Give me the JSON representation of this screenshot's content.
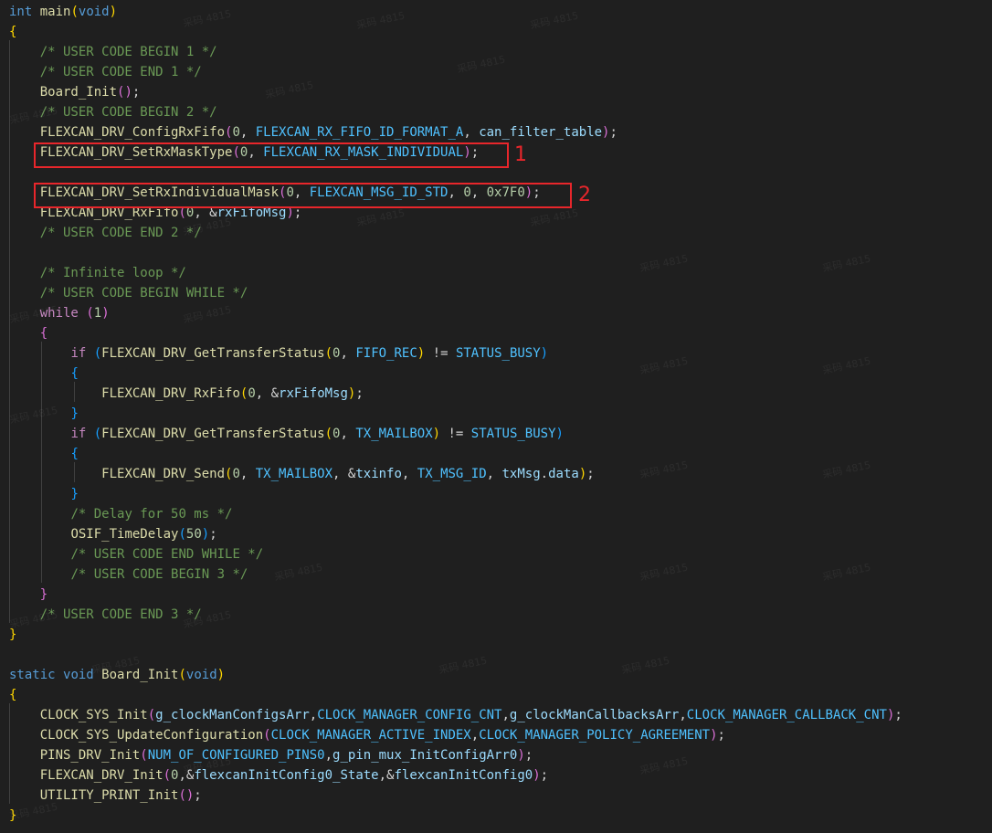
{
  "annotations": {
    "mark1": "1",
    "mark2": "2"
  },
  "watermark": "采码 4815",
  "colors": {
    "background": "#1f1f1f",
    "keyword": "#569cd6",
    "control": "#c586c0",
    "function": "#dcdcaa",
    "number": "#b5cea8",
    "macro": "#4fc1ff",
    "variable": "#9cdcfe",
    "comment": "#6a9955",
    "highlight": "#e8262b"
  },
  "code_lines": [
    [
      [
        "kw",
        "int"
      ],
      [
        "pl",
        " "
      ],
      [
        "fn",
        "main"
      ],
      [
        "br1",
        "("
      ],
      [
        "kw",
        "void"
      ],
      [
        "br1",
        ")"
      ]
    ],
    [
      [
        "br1",
        "{"
      ]
    ],
    [
      [
        "pl",
        "    "
      ],
      [
        "cm",
        "/* USER CODE BEGIN 1 */"
      ]
    ],
    [
      [
        "pl",
        "    "
      ],
      [
        "cm",
        "/* USER CODE END 1 */"
      ]
    ],
    [
      [
        "pl",
        "    "
      ],
      [
        "fn",
        "Board_Init"
      ],
      [
        "br2",
        "()"
      ],
      [
        "pl",
        ";"
      ]
    ],
    [
      [
        "pl",
        "    "
      ],
      [
        "cm",
        "/* USER CODE BEGIN 2 */"
      ]
    ],
    [
      [
        "pl",
        "    "
      ],
      [
        "fn",
        "FLEXCAN_DRV_ConfigRxFifo"
      ],
      [
        "br2",
        "("
      ],
      [
        "num",
        "0"
      ],
      [
        "pl",
        ", "
      ],
      [
        "mac",
        "FLEXCAN_RX_FIFO_ID_FORMAT_A"
      ],
      [
        "pl",
        ", "
      ],
      [
        "var",
        "can_filter_table"
      ],
      [
        "br2",
        ")"
      ],
      [
        "pl",
        ";"
      ]
    ],
    [
      [
        "pl",
        "    "
      ],
      [
        "fn",
        "FLEXCAN_DRV_SetRxMaskType"
      ],
      [
        "br2",
        "("
      ],
      [
        "num",
        "0"
      ],
      [
        "pl",
        ", "
      ],
      [
        "mac",
        "FLEXCAN_RX_MASK_INDIVIDUAL"
      ],
      [
        "br2",
        ")"
      ],
      [
        "pl",
        ";"
      ]
    ],
    [],
    [
      [
        "pl",
        "    "
      ],
      [
        "fn",
        "FLEXCAN_DRV_SetRxIndividualMask"
      ],
      [
        "br2",
        "("
      ],
      [
        "num",
        "0"
      ],
      [
        "pl",
        ", "
      ],
      [
        "mac",
        "FLEXCAN_MSG_ID_STD"
      ],
      [
        "pl",
        ", "
      ],
      [
        "num",
        "0"
      ],
      [
        "pl",
        ", "
      ],
      [
        "num",
        "0x7F0"
      ],
      [
        "br2",
        ")"
      ],
      [
        "pl",
        ";"
      ]
    ],
    [
      [
        "pl",
        "    "
      ],
      [
        "fn",
        "FLEXCAN_DRV_RxFifo"
      ],
      [
        "br2",
        "("
      ],
      [
        "num",
        "0"
      ],
      [
        "pl",
        ", &"
      ],
      [
        "var",
        "rxFifoMsg"
      ],
      [
        "br2",
        ")"
      ],
      [
        "pl",
        ";"
      ]
    ],
    [
      [
        "pl",
        "    "
      ],
      [
        "cm",
        "/* USER CODE END 2 */"
      ]
    ],
    [],
    [
      [
        "pl",
        "    "
      ],
      [
        "cm",
        "/* Infinite loop */"
      ]
    ],
    [
      [
        "pl",
        "    "
      ],
      [
        "cm",
        "/* USER CODE BEGIN WHILE */"
      ]
    ],
    [
      [
        "pl",
        "    "
      ],
      [
        "ctrl",
        "while"
      ],
      [
        "pl",
        " "
      ],
      [
        "br2",
        "("
      ],
      [
        "num",
        "1"
      ],
      [
        "br2",
        ")"
      ]
    ],
    [
      [
        "pl",
        "    "
      ],
      [
        "br2",
        "{"
      ]
    ],
    [
      [
        "pl",
        "        "
      ],
      [
        "ctrl",
        "if"
      ],
      [
        "pl",
        " "
      ],
      [
        "br3",
        "("
      ],
      [
        "fn",
        "FLEXCAN_DRV_GetTransferStatus"
      ],
      [
        "br1",
        "("
      ],
      [
        "num",
        "0"
      ],
      [
        "pl",
        ", "
      ],
      [
        "mac",
        "FIFO_REC"
      ],
      [
        "br1",
        ")"
      ],
      [
        "pl",
        " != "
      ],
      [
        "mac",
        "STATUS_BUSY"
      ],
      [
        "br3",
        ")"
      ]
    ],
    [
      [
        "pl",
        "        "
      ],
      [
        "br3",
        "{"
      ]
    ],
    [
      [
        "pl",
        "            "
      ],
      [
        "fn",
        "FLEXCAN_DRV_RxFifo"
      ],
      [
        "br1",
        "("
      ],
      [
        "num",
        "0"
      ],
      [
        "pl",
        ", &"
      ],
      [
        "var",
        "rxFifoMsg"
      ],
      [
        "br1",
        ")"
      ],
      [
        "pl",
        ";"
      ]
    ],
    [
      [
        "pl",
        "        "
      ],
      [
        "br3",
        "}"
      ]
    ],
    [
      [
        "pl",
        "        "
      ],
      [
        "ctrl",
        "if"
      ],
      [
        "pl",
        " "
      ],
      [
        "br3",
        "("
      ],
      [
        "fn",
        "FLEXCAN_DRV_GetTransferStatus"
      ],
      [
        "br1",
        "("
      ],
      [
        "num",
        "0"
      ],
      [
        "pl",
        ", "
      ],
      [
        "mac",
        "TX_MAILBOX"
      ],
      [
        "br1",
        ")"
      ],
      [
        "pl",
        " != "
      ],
      [
        "mac",
        "STATUS_BUSY"
      ],
      [
        "br3",
        ")"
      ]
    ],
    [
      [
        "pl",
        "        "
      ],
      [
        "br3",
        "{"
      ]
    ],
    [
      [
        "pl",
        "            "
      ],
      [
        "fn",
        "FLEXCAN_DRV_Send"
      ],
      [
        "br1",
        "("
      ],
      [
        "num",
        "0"
      ],
      [
        "pl",
        ", "
      ],
      [
        "mac",
        "TX_MAILBOX"
      ],
      [
        "pl",
        ", &"
      ],
      [
        "var",
        "txinfo"
      ],
      [
        "pl",
        ", "
      ],
      [
        "mac",
        "TX_MSG_ID"
      ],
      [
        "pl",
        ", "
      ],
      [
        "var",
        "txMsg"
      ],
      [
        "pl",
        "."
      ],
      [
        "var",
        "data"
      ],
      [
        "br1",
        ")"
      ],
      [
        "pl",
        ";"
      ]
    ],
    [
      [
        "pl",
        "        "
      ],
      [
        "br3",
        "}"
      ]
    ],
    [
      [
        "pl",
        "        "
      ],
      [
        "cm",
        "/* Delay for 50 ms */"
      ]
    ],
    [
      [
        "pl",
        "        "
      ],
      [
        "fn",
        "OSIF_TimeDelay"
      ],
      [
        "br3",
        "("
      ],
      [
        "num",
        "50"
      ],
      [
        "br3",
        ")"
      ],
      [
        "pl",
        ";"
      ]
    ],
    [
      [
        "pl",
        "        "
      ],
      [
        "cm",
        "/* USER CODE END WHILE */"
      ]
    ],
    [
      [
        "pl",
        "        "
      ],
      [
        "cm",
        "/* USER CODE BEGIN 3 */"
      ]
    ],
    [
      [
        "pl",
        "    "
      ],
      [
        "br2",
        "}"
      ]
    ],
    [
      [
        "pl",
        "    "
      ],
      [
        "cm",
        "/* USER CODE END 3 */"
      ]
    ],
    [
      [
        "br1",
        "}"
      ]
    ],
    [],
    [
      [
        "kw",
        "static"
      ],
      [
        "pl",
        " "
      ],
      [
        "kw",
        "void"
      ],
      [
        "pl",
        " "
      ],
      [
        "fn",
        "Board_Init"
      ],
      [
        "br1",
        "("
      ],
      [
        "kw",
        "void"
      ],
      [
        "br1",
        ")"
      ]
    ],
    [
      [
        "br1",
        "{"
      ]
    ],
    [
      [
        "pl",
        "    "
      ],
      [
        "fn",
        "CLOCK_SYS_Init"
      ],
      [
        "br2",
        "("
      ],
      [
        "var",
        "g_clockManConfigsArr"
      ],
      [
        "pl",
        ","
      ],
      [
        "mac",
        "CLOCK_MANAGER_CONFIG_CNT"
      ],
      [
        "pl",
        ","
      ],
      [
        "var",
        "g_clockManCallbacksArr"
      ],
      [
        "pl",
        ","
      ],
      [
        "mac",
        "CLOCK_MANAGER_CALLBACK_CNT"
      ],
      [
        "br2",
        ")"
      ],
      [
        "pl",
        ";"
      ]
    ],
    [
      [
        "pl",
        "    "
      ],
      [
        "fn",
        "CLOCK_SYS_UpdateConfiguration"
      ],
      [
        "br2",
        "("
      ],
      [
        "mac",
        "CLOCK_MANAGER_ACTIVE_INDEX"
      ],
      [
        "pl",
        ","
      ],
      [
        "mac",
        "CLOCK_MANAGER_POLICY_AGREEMENT"
      ],
      [
        "br2",
        ")"
      ],
      [
        "pl",
        ";"
      ]
    ],
    [
      [
        "pl",
        "    "
      ],
      [
        "fn",
        "PINS_DRV_Init"
      ],
      [
        "br2",
        "("
      ],
      [
        "mac",
        "NUM_OF_CONFIGURED_PINS0"
      ],
      [
        "pl",
        ","
      ],
      [
        "var",
        "g_pin_mux_InitConfigArr0"
      ],
      [
        "br2",
        ")"
      ],
      [
        "pl",
        ";"
      ]
    ],
    [
      [
        "pl",
        "    "
      ],
      [
        "fn",
        "FLEXCAN_DRV_Init"
      ],
      [
        "br2",
        "("
      ],
      [
        "num",
        "0"
      ],
      [
        "pl",
        ",&"
      ],
      [
        "var",
        "flexcanInitConfig0_State"
      ],
      [
        "pl",
        ",&"
      ],
      [
        "var",
        "flexcanInitConfig0"
      ],
      [
        "br2",
        ")"
      ],
      [
        "pl",
        ";"
      ]
    ],
    [
      [
        "pl",
        "    "
      ],
      [
        "fn",
        "UTILITY_PRINT_Init"
      ],
      [
        "br2",
        "()"
      ],
      [
        "pl",
        ";"
      ]
    ],
    [
      [
        "br1",
        "}"
      ]
    ]
  ]
}
